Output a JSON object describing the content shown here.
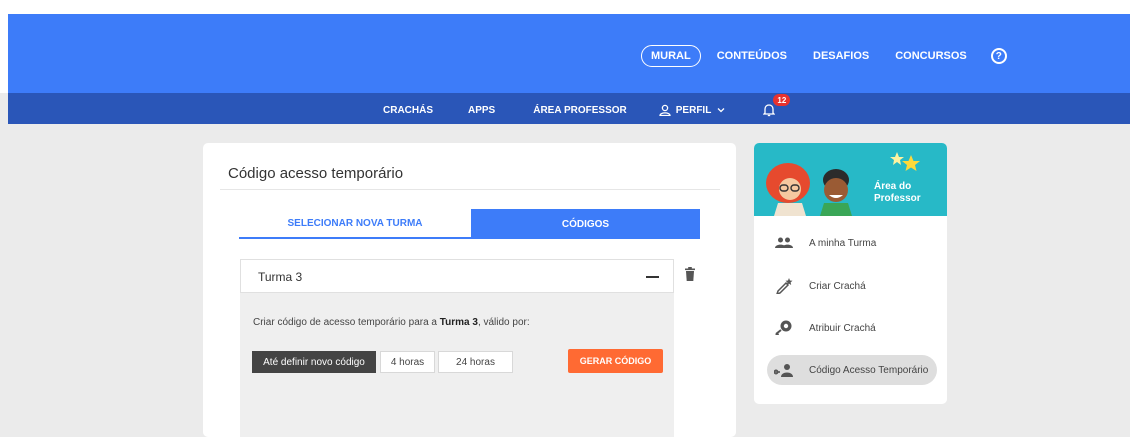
{
  "top_nav": {
    "items": [
      {
        "label": "MURAL",
        "active": true
      },
      {
        "label": "CONTEÚDOS"
      },
      {
        "label": "DESAFIOS"
      },
      {
        "label": "CONCURSOS"
      }
    ],
    "help_icon": "question-circle-icon"
  },
  "sub_nav": {
    "items": [
      {
        "label": "CRACHÁS"
      },
      {
        "label": "APPS"
      },
      {
        "label": "ÁREA PROFESSOR"
      },
      {
        "label": "PERFIL",
        "icon": "user-icon",
        "caret": "chevron-down-icon"
      }
    ],
    "notifications": {
      "icon": "bell-icon",
      "count": "12"
    }
  },
  "main": {
    "title": "Código acesso temporário",
    "tabs": [
      {
        "label": "SELECIONAR NOVA TURMA",
        "active": false
      },
      {
        "label": "CÓDIGOS",
        "active": true
      }
    ],
    "turma": {
      "name": "Turma 3",
      "description_prefix": "Criar código de acesso temporário para a ",
      "description_bold": "Turma 3",
      "description_suffix": ", válido por:",
      "options": [
        "Até definir novo código",
        "4 horas",
        "24 horas"
      ],
      "selected_option": "Até definir novo código",
      "generate_label": "GERAR CÓDIGO"
    }
  },
  "sidebar": {
    "banner_title_line1": "Área do",
    "banner_title_line2": "Professor",
    "items": [
      {
        "label": "A minha Turma",
        "icon": "group-icon"
      },
      {
        "label": "Criar Crachá",
        "icon": "pencil-badge-icon"
      },
      {
        "label": "Atribuir Crachá",
        "icon": "assign-badge-icon"
      },
      {
        "label": "Código Acesso Temporário",
        "icon": "user-key-icon",
        "active": true
      }
    ]
  },
  "colors": {
    "primary_blue": "#3d7cf9",
    "dark_blue": "#2a56b8",
    "orange": "#ff6a33",
    "teal": "#27b9c7"
  }
}
